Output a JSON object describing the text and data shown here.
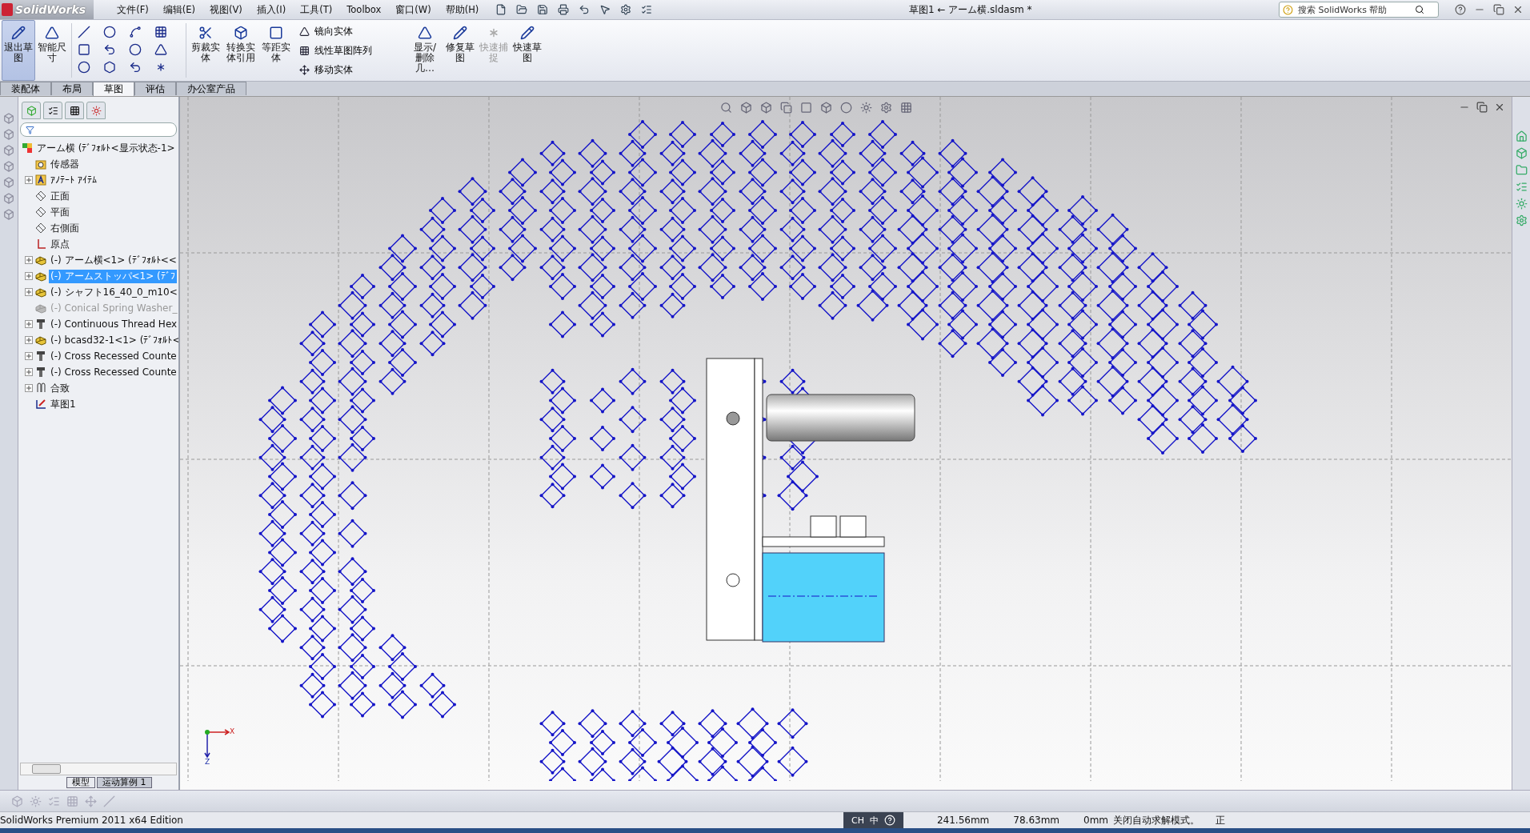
{
  "app_name": "SolidWorks",
  "menu": [
    "文件(F)",
    "编辑(E)",
    "视图(V)",
    "插入(I)",
    "工具(T)",
    "Toolbox",
    "窗口(W)",
    "帮助(H)"
  ],
  "document_title": "草图1 ← アーム横.sldasm *",
  "help_search": {
    "placeholder": "搜索 SolidWorks 帮助"
  },
  "ribbon": [
    {
      "kind": "large",
      "label": "退出草图",
      "pressed": true,
      "disabled": false
    },
    {
      "kind": "large",
      "label": "智能尺寸",
      "pressed": false,
      "disabled": false
    },
    {
      "kind": "tools"
    },
    {
      "kind": "large",
      "label": "剪裁实体",
      "pressed": false,
      "disabled": false
    },
    {
      "kind": "large",
      "label": "转换实体引用",
      "pressed": false,
      "disabled": false
    },
    {
      "kind": "large",
      "label": "等距实体",
      "pressed": false,
      "disabled": false
    },
    {
      "kind": "list",
      "items": [
        "镜向实体",
        "线性草图阵列",
        "移动实体"
      ]
    },
    {
      "kind": "large",
      "label": "显示/删除几…",
      "pressed": false,
      "disabled": false
    },
    {
      "kind": "large",
      "label": "修复草图",
      "pressed": false,
      "disabled": false
    },
    {
      "kind": "large",
      "label": "快速捕捉",
      "pressed": false,
      "disabled": true
    },
    {
      "kind": "large",
      "label": "快速草图",
      "pressed": false,
      "disabled": false
    }
  ],
  "tabs": [
    {
      "label": "装配体",
      "selected": false
    },
    {
      "label": "布局",
      "selected": false
    },
    {
      "label": "草图",
      "selected": true
    },
    {
      "label": "评估",
      "selected": false
    },
    {
      "label": "办公室产品",
      "selected": false
    }
  ],
  "feature_tree": {
    "root": {
      "label": "アーム横  (ﾃﾞﾌｫﾙﾄ<显示状态-1>",
      "children": [
        {
          "kind": "sensor",
          "label": "传感器",
          "expandable": false,
          "selected": false,
          "suppressed": false
        },
        {
          "kind": "annotation",
          "label": "ｱﾉﾃｰﾄ ｱｲﾃﾑ",
          "expandable": true,
          "selected": false,
          "suppressed": false
        },
        {
          "kind": "plane",
          "label": "正面",
          "expandable": false,
          "selected": false,
          "suppressed": false
        },
        {
          "kind": "plane",
          "label": "平面",
          "expandable": false,
          "selected": false,
          "suppressed": false
        },
        {
          "kind": "plane",
          "label": "右側面",
          "expandable": false,
          "selected": false,
          "suppressed": false
        },
        {
          "kind": "origin",
          "label": "原点",
          "expandable": false,
          "selected": false,
          "suppressed": false
        },
        {
          "kind": "part",
          "label": "(-) アーム横<1> (ﾃﾞﾌｫﾙﾄ<<",
          "expandable": true,
          "selected": false,
          "suppressed": false
        },
        {
          "kind": "part",
          "label": "(-) アームストッパ<1> (ﾃﾞﾌ",
          "expandable": true,
          "selected": true,
          "suppressed": false
        },
        {
          "kind": "part",
          "label": "(-) シャフト16_40_0_m10<",
          "expandable": true,
          "selected": false,
          "suppressed": false
        },
        {
          "kind": "part",
          "label": "(-) Conical Spring Washer_",
          "expandable": false,
          "selected": false,
          "suppressed": true
        },
        {
          "kind": "screw",
          "label": "(-) Continuous Thread Hex",
          "expandable": true,
          "selected": false,
          "suppressed": false
        },
        {
          "kind": "part",
          "label": "(-) bcasd32-1<1> (ﾃﾞﾌｫﾙﾄ<",
          "expandable": true,
          "selected": false,
          "suppressed": false
        },
        {
          "kind": "screw",
          "label": "(-) Cross Recessed Counte",
          "expandable": true,
          "selected": false,
          "suppressed": false
        },
        {
          "kind": "screw",
          "label": "(-) Cross Recessed Counte",
          "expandable": true,
          "selected": false,
          "suppressed": false
        },
        {
          "kind": "mates",
          "label": "合致",
          "expandable": true,
          "selected": false,
          "suppressed": false
        },
        {
          "kind": "sketch",
          "label": "草图1",
          "expandable": false,
          "selected": false,
          "suppressed": false
        }
      ]
    }
  },
  "triad": {
    "x": "X",
    "z": "Z"
  },
  "bottom_tabs": [
    {
      "label": "模型",
      "selected": true
    },
    {
      "label": "运动算例 1",
      "selected": false
    }
  ],
  "status_bar": {
    "product": "SolidWorks Premium 2011 x64 Edition",
    "language": "CH",
    "ime": "中",
    "readings": [
      "241.56mm",
      "78.63mm",
      "0mm"
    ],
    "message": "关闭自动求解模式。",
    "edit_state": "正"
  }
}
